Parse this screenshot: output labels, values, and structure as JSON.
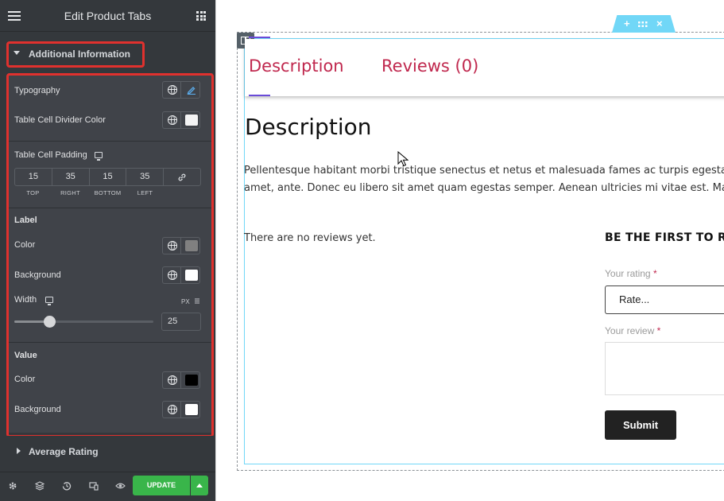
{
  "panel": {
    "title": "Edit Product Tabs",
    "section_active": "Additional Information",
    "section_next": "Average Rating",
    "controls": {
      "typography": "Typography",
      "divider_color": "Table Cell Divider Color",
      "padding_label": "Table Cell Padding",
      "padding": {
        "top": "15",
        "right": "35",
        "bottom": "15",
        "left": "35"
      },
      "padding_units": {
        "top": "TOP",
        "right": "RIGHT",
        "bottom": "BOTTOM",
        "left": "LEFT"
      },
      "label_heading": "Label",
      "label_color": "Color",
      "label_background": "Background",
      "width_label": "Width",
      "width_unit": "PX",
      "width_value": "25",
      "value_heading": "Value",
      "value_color": "Color",
      "value_background": "Background"
    },
    "colors": {
      "divider_swatch": "#f4f4f4",
      "label_color_swatch": "#808080",
      "label_bg_swatch": "#ffffff",
      "value_color_swatch": "#000000",
      "value_bg_swatch": "#ffffff",
      "accent_green": "#39b54a",
      "highlight_red": "#e0312e"
    },
    "footer": {
      "update_label": "UPDATE"
    }
  },
  "preview": {
    "tabs": [
      "Description",
      "Reviews (0)"
    ],
    "heading": "Description",
    "paragraph_line1": "Pellentesque habitant morbi tristique senectus et netus et malesuada fames ac turpis egestas. V",
    "paragraph_line2": "amet, ante. Donec eu libero sit amet quam egestas semper. Aenean ultricies mi vitae est. Mauris",
    "no_reviews": "There are no reviews yet.",
    "first_review": "BE THE FIRST TO RE",
    "rating_label": "Your rating",
    "review_label": "Your review",
    "required_mark": "*",
    "rate_select": "Rate...",
    "submit": "Submit",
    "handle_plus": "+",
    "handle_close": "×",
    "accent_color": "#c0284e"
  }
}
